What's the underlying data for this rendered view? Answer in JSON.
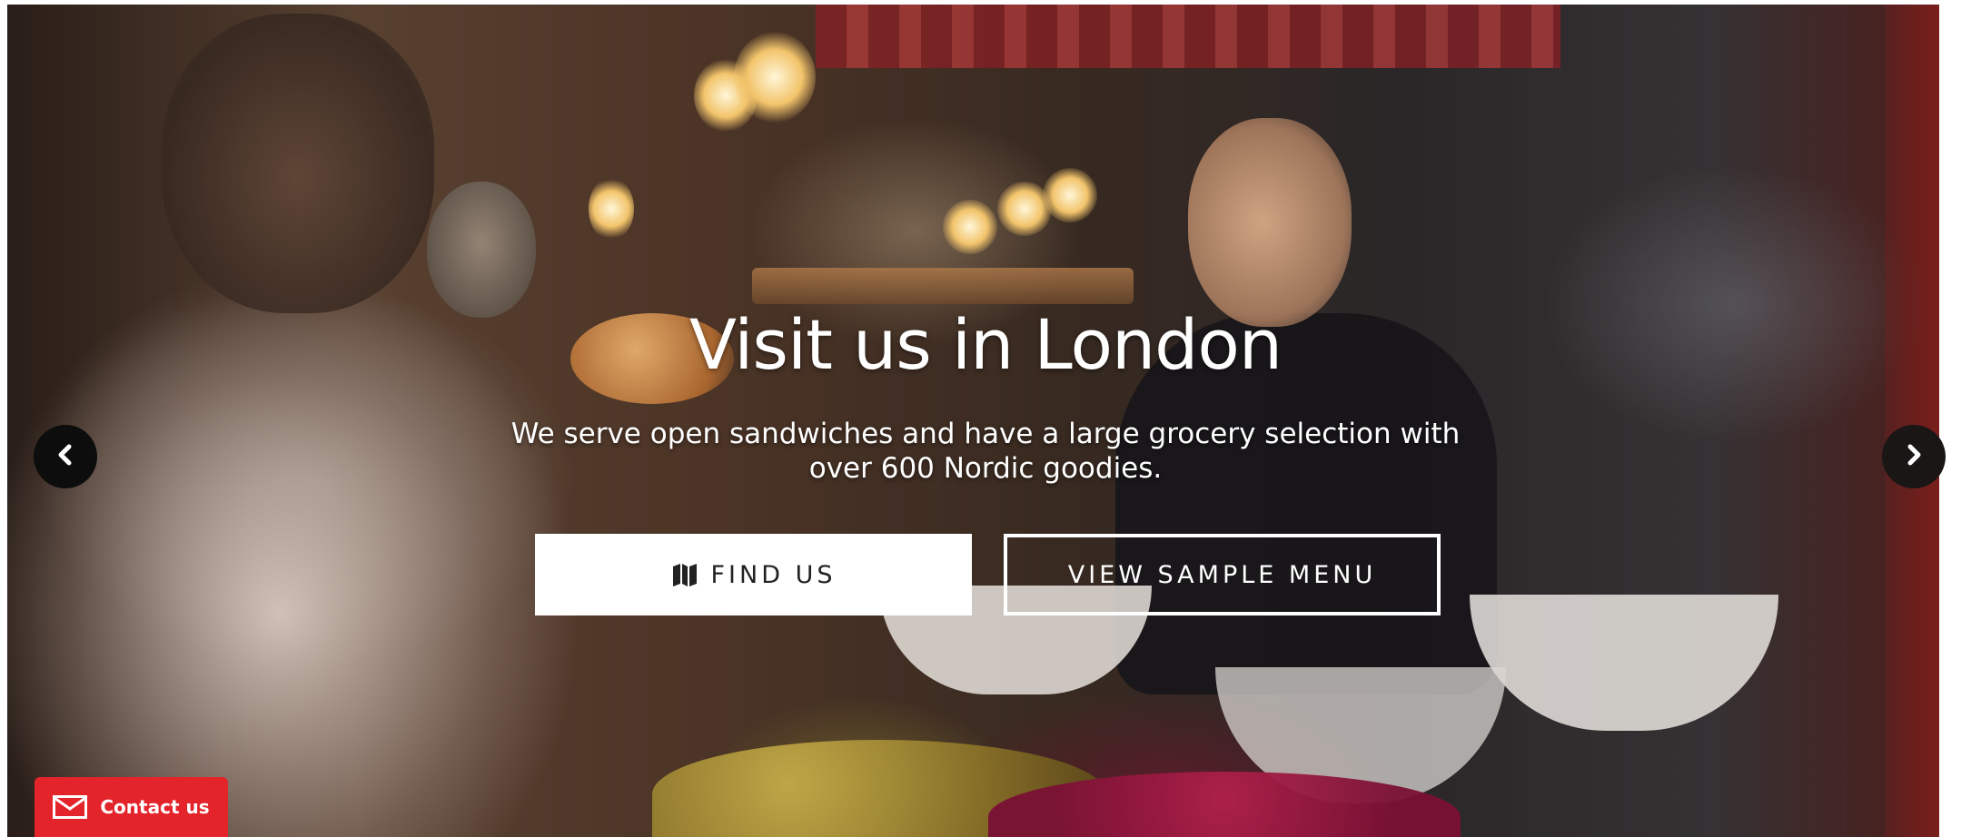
{
  "hero": {
    "title": "Visit us in London",
    "subtitle": "We serve open sandwiches and have a large grocery selection with over 600 Nordic goodies."
  },
  "buttons": {
    "find_us": {
      "label": "FIND US",
      "icon": "map-icon"
    },
    "view_menu": {
      "label": "VIEW SAMPLE MENU"
    }
  },
  "carousel": {
    "prev_icon": "chevron-left-icon",
    "next_icon": "chevron-right-icon"
  },
  "contact": {
    "label": "Contact us",
    "icon": "envelope-icon"
  },
  "colors": {
    "contact_red": "#e3242b",
    "button_white": "#ffffff",
    "arrow_black": "#0d0d0d"
  }
}
